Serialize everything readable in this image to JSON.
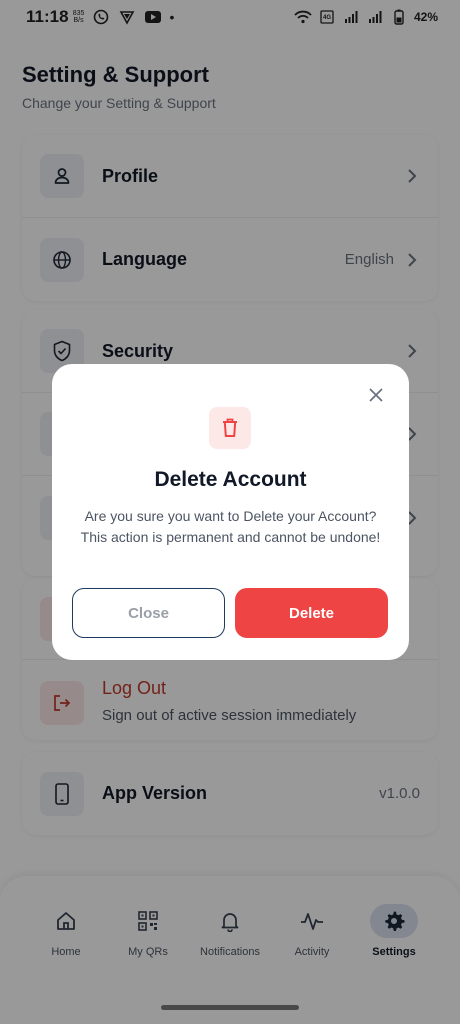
{
  "status_bar": {
    "time": "11:18",
    "kbs": "835 B/s",
    "battery": "42%"
  },
  "header": {
    "title": "Setting & Support",
    "subtitle": "Change your Setting & Support"
  },
  "settings": {
    "profile_label": "Profile",
    "language_label": "Language",
    "language_value": "English",
    "security_label": "Security",
    "logout_label": "Log Out",
    "logout_sub": "Sign out of active session immediately",
    "app_version_label": "App Version",
    "app_version_value": "v1.0.0"
  },
  "modal": {
    "title": "Delete Account",
    "message": "Are you sure you want to Delete your Account? This action is permanent and cannot be undone!",
    "close_label": "Close",
    "delete_label": "Delete"
  },
  "nav": {
    "items": [
      {
        "label": "Home",
        "icon": "home-icon"
      },
      {
        "label": "My QRs",
        "icon": "qr-icon"
      },
      {
        "label": "Notifications",
        "icon": "bell-icon"
      },
      {
        "label": "Activity",
        "icon": "activity-icon"
      },
      {
        "label": "Settings",
        "icon": "gear-icon"
      }
    ],
    "active": "Settings"
  },
  "colors": {
    "danger": "#ef4444",
    "navy": "#1e3a5f",
    "nav_active_bg": "#d9e2f1"
  }
}
